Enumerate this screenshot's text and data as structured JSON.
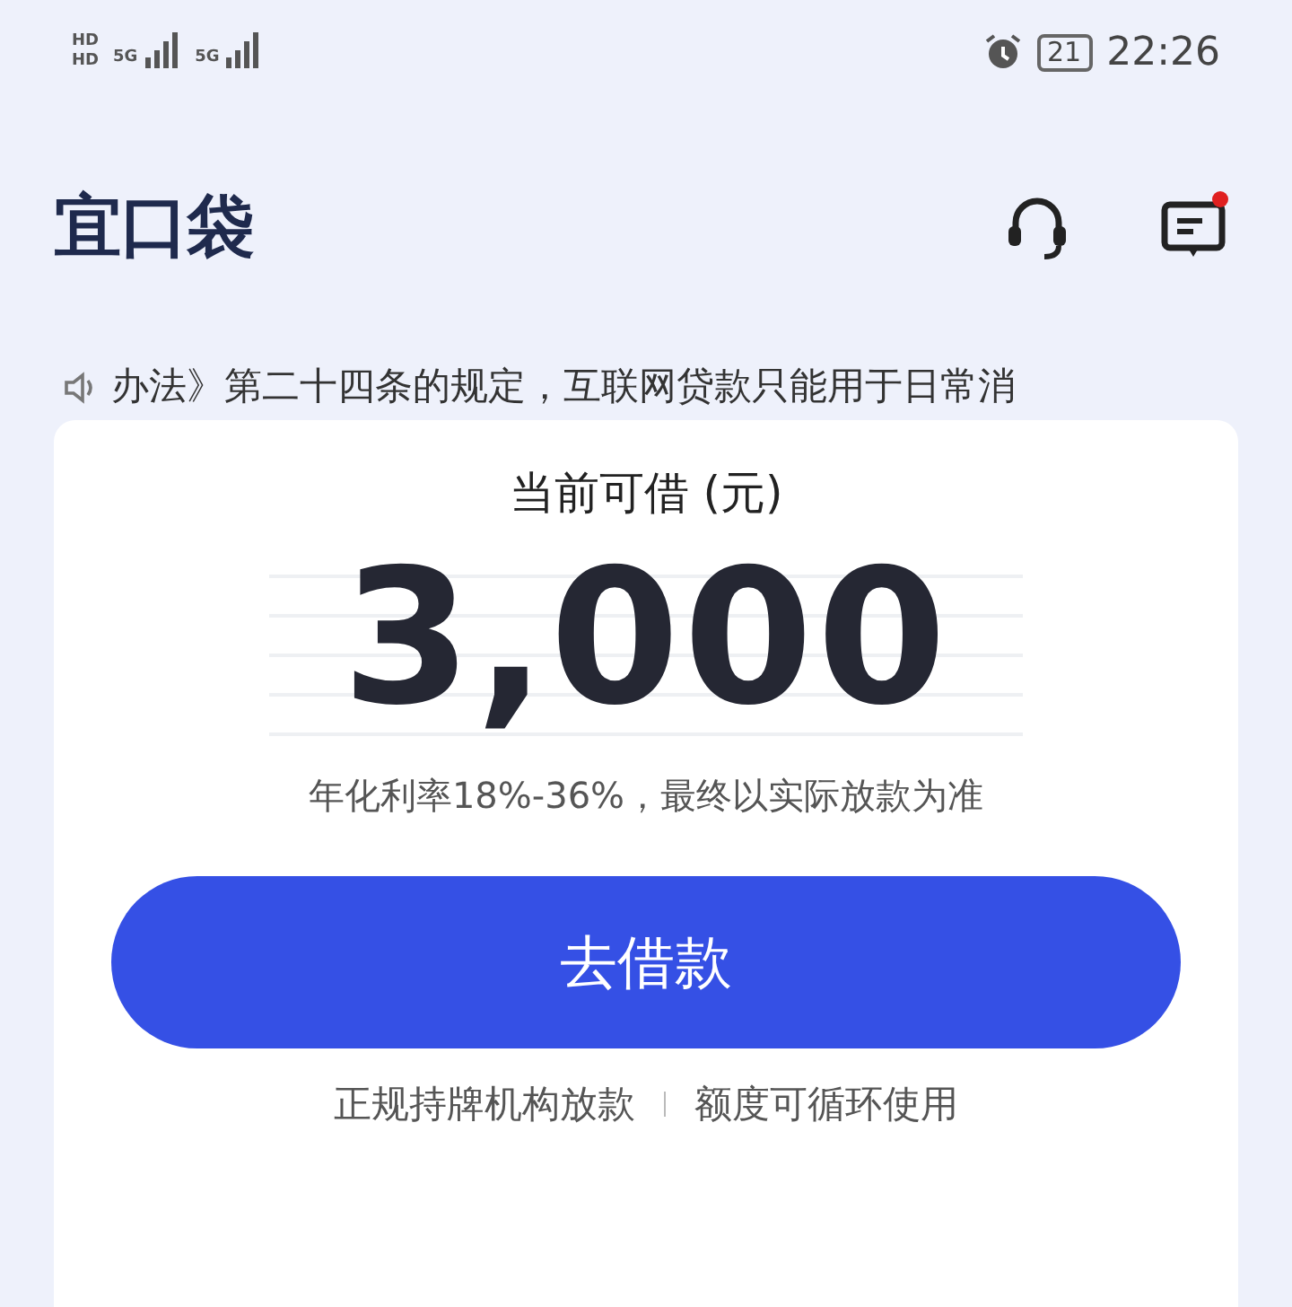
{
  "status_bar": {
    "sim_labels": [
      "HD",
      "HD"
    ],
    "network_labels": [
      "5G",
      "5G"
    ],
    "battery": "21",
    "time": "22:26"
  },
  "header": {
    "logo": "宜口袋",
    "has_message_dot": true
  },
  "notice": {
    "text": "办法》第二十四条的规定，互联网贷款只能用于日常消"
  },
  "card": {
    "title": "当前可借 (元)",
    "amount": "3,000",
    "rate_note": "年化利率18%-36%，最终以实际放款为准",
    "button": "去借款",
    "features": [
      "正规持牌机构放款",
      "额度可循环使用"
    ]
  }
}
